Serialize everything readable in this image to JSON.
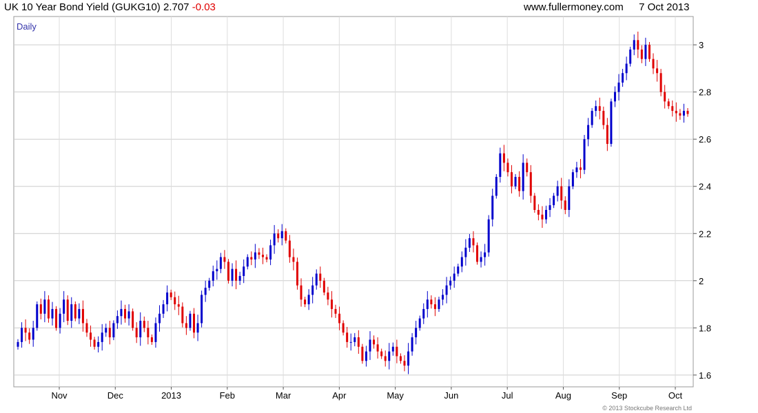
{
  "header": {
    "symbol_text": "UK 10 Year Bond Yield (GUKG10)",
    "last_value": "2.707",
    "change": "-0.03",
    "site": "www.fullermoney.com",
    "date": "7 Oct 2013"
  },
  "chart_data": {
    "type": "candlestick",
    "interval_label": "Daily",
    "ylim": [
      1.55,
      3.12
    ],
    "y_ticks": [
      "1.6",
      "1.8",
      "2",
      "2.2",
      "2.4",
      "2.6",
      "2.8",
      "3"
    ],
    "x_ticks": [
      "Nov",
      "Dec",
      "2013",
      "Feb",
      "Mar",
      "Apr",
      "May",
      "Jun",
      "Jul",
      "Aug",
      "Sep",
      "Oct"
    ],
    "grid": true,
    "up_color": "#0000cc",
    "down_color": "#e00000",
    "series": [
      {
        "values": [
          1.74,
          1.8,
          1.78,
          1.75,
          1.8,
          1.9,
          1.86,
          1.92,
          1.84,
          1.88,
          1.8,
          1.86,
          1.92,
          1.83,
          1.9,
          1.84,
          1.88,
          1.82,
          1.78,
          1.75,
          1.72,
          1.74,
          1.78,
          1.8,
          1.76,
          1.82,
          1.85,
          1.88,
          1.84,
          1.87,
          1.8,
          1.76,
          1.83,
          1.8,
          1.76,
          1.74,
          1.82,
          1.86,
          1.9,
          1.95,
          1.93,
          1.9,
          1.89
        ]
      },
      {
        "values": [
          1.82,
          1.8,
          1.86,
          1.78,
          1.82,
          1.94,
          1.97,
          2.0,
          2.04,
          2.05,
          2.1,
          2.08,
          2.0,
          2.05,
          2.0,
          2.02,
          2.06,
          2.1,
          2.09,
          2.12,
          2.11,
          2.1,
          2.09,
          2.15,
          2.2,
          2.18,
          2.21,
          2.17,
          2.1,
          2.08
        ]
      },
      {
        "values": [
          1.98,
          1.92,
          1.9,
          1.94,
          1.98,
          2.03,
          2.0,
          1.95,
          1.92,
          1.88,
          1.86,
          1.82,
          1.78,
          1.74,
          1.74,
          1.76,
          1.72,
          1.66,
          1.7,
          1.75,
          1.73,
          1.7,
          1.68,
          1.66,
          1.7,
          1.72,
          1.68,
          1.66,
          1.64,
          1.7,
          1.76,
          1.8,
          1.84,
          1.88,
          1.92,
          1.9,
          1.88,
          1.92,
          1.94,
          1.98,
          2.0,
          2.03,
          2.06,
          2.1,
          2.14,
          2.18,
          2.15,
          2.08,
          2.1,
          2.12
        ]
      },
      {
        "values": [
          2.26,
          2.36,
          2.44,
          2.54,
          2.5,
          2.46,
          2.4,
          2.44,
          2.38,
          2.5,
          2.46,
          2.36,
          2.3,
          2.28,
          2.26,
          2.3,
          2.32,
          2.36,
          2.4,
          2.34,
          2.3,
          2.4,
          2.46,
          2.48,
          2.47,
          2.6,
          2.66,
          2.72,
          2.74,
          2.72,
          2.66,
          2.58,
          2.76,
          2.8,
          2.84,
          2.88,
          2.92,
          2.98,
          3.02,
          2.98,
          2.94,
          3.0,
          2.94,
          2.9,
          2.88,
          2.8,
          2.76,
          2.74,
          2.72,
          2.71,
          2.7,
          2.72,
          2.707
        ]
      }
    ],
    "copyright": "© 2013 Stockcube Research Ltd"
  }
}
